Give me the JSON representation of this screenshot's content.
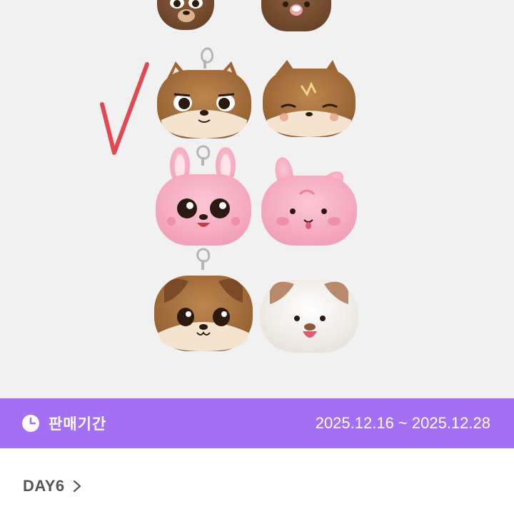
{
  "sale_period": {
    "label": "판매기간",
    "dates": "2025.12.16 ~ 2025.12.28",
    "bar_color": "#a46ff2",
    "icon": "clock-icon"
  },
  "artist": {
    "name": "DAY6",
    "icon": "chevron-right-icon"
  },
  "product": {
    "annotation_color": "#e3474f",
    "colors": {
      "brown": "#a8703f",
      "pink": "#f9b4c9",
      "white": "#f6f2ee",
      "background": "#f1f1f1"
    }
  }
}
